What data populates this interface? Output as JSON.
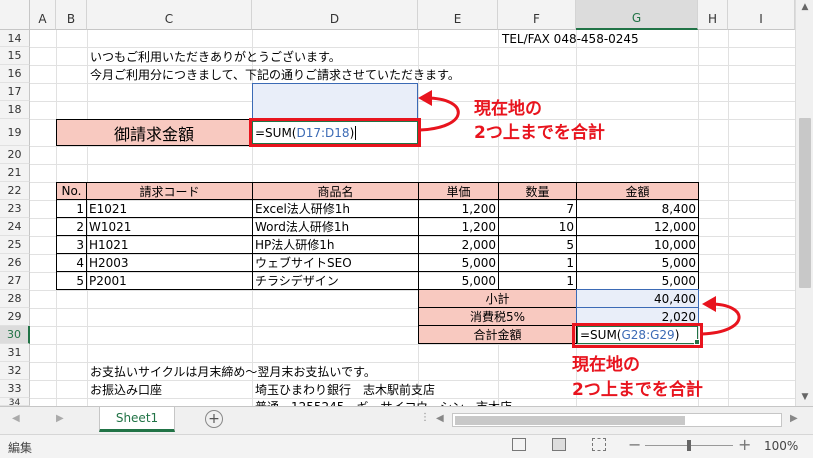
{
  "columns": [
    "A",
    "B",
    "C",
    "D",
    "E",
    "F",
    "G",
    "H",
    "I"
  ],
  "selected_column": "G",
  "rows": [
    "14",
    "15",
    "16",
    "17",
    "18",
    "19",
    "20",
    "21",
    "22",
    "23",
    "24",
    "25",
    "26",
    "27",
    "28",
    "29",
    "30",
    "31",
    "32",
    "33",
    "34"
  ],
  "selected_row": "30",
  "header": {
    "tel_fax": "TEL/FAX 048-458-0245",
    "greeting1": "いつもご利用いただきありがとうございます。",
    "greeting2": "今月ご利用分につきまして、下記の通りご請求させていただきます。"
  },
  "invoice": {
    "label": "御請求金額",
    "formula_prefix": "=SUM(",
    "formula_ref": "D17:D18",
    "formula_suffix": ")"
  },
  "table": {
    "headers": [
      "No.",
      "請求コード",
      "商品名",
      "単価",
      "数量",
      "金額"
    ],
    "rows": [
      [
        "1",
        "E1021",
        "Excel法人研修1h",
        "1,200",
        "7",
        "8,400"
      ],
      [
        "2",
        "W1021",
        "Word法人研修1h",
        "1,200",
        "10",
        "12,000"
      ],
      [
        "3",
        "H1021",
        "HP法人研修1h",
        "2,000",
        "5",
        "10,000"
      ],
      [
        "4",
        "H2003",
        "ウェブサイトSEO",
        "5,000",
        "1",
        "5,000"
      ],
      [
        "5",
        "P2001",
        "チラシデザイン",
        "5,000",
        "1",
        "5,000"
      ]
    ]
  },
  "summary": {
    "subtotal_label": "小計",
    "subtotal_value": "40,400",
    "tax_label": "消費税5%",
    "tax_value": "2,020",
    "total_label": "合計金額",
    "total_formula_prefix": "=SUM(",
    "total_formula_ref": "G28:G29",
    "total_formula_suffix": ")"
  },
  "footer": {
    "payment_cycle": "お支払いサイクルは月末締め～翌月末お支払いです。",
    "bank_label": "お振込み口座",
    "bank_name": "埼玉ひまわり銀行　志木駅前支店",
    "account_partial": "普通　1255245　ギ　サイコウ　シン　市木店"
  },
  "annotations": {
    "note1_line1": "現在地の",
    "note1_line2": "2つ上までを合計",
    "note2_line1": "現在地の",
    "note2_line2": "2つ上までを合計"
  },
  "sheet_tab": "Sheet1",
  "status": {
    "mode": "編集",
    "zoom": "100%"
  },
  "colors": {
    "pink_fill": "#f8c9c0",
    "blue_fill": "#e9eef9",
    "annotation_red": "#e8141e",
    "excel_green": "#217346"
  }
}
